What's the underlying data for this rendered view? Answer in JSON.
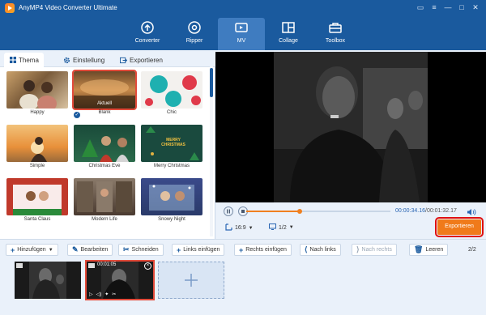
{
  "app": {
    "title": "AnyMP4 Video Converter Ultimate"
  },
  "nav": [
    {
      "label": "Converter",
      "icon": "converter-icon"
    },
    {
      "label": "Ripper",
      "icon": "ripper-icon"
    },
    {
      "label": "MV",
      "icon": "mv-icon"
    },
    {
      "label": "Collage",
      "icon": "collage-icon"
    },
    {
      "label": "Toolbox",
      "icon": "toolbox-icon"
    }
  ],
  "tabs": [
    {
      "label": "Thema"
    },
    {
      "label": "Einstellung"
    },
    {
      "label": "Exportieren"
    }
  ],
  "themes": [
    {
      "label": "Happy"
    },
    {
      "label": "Blank",
      "overlay": "Aktuell",
      "selected": true
    },
    {
      "label": "Chic"
    },
    {
      "label": "Simple"
    },
    {
      "label": "Christmas Eve"
    },
    {
      "label": "Merry Christmas",
      "overlay": "MERRY CHRISTMAS"
    },
    {
      "label": "Santa Claus"
    },
    {
      "label": "Modern Life"
    },
    {
      "label": "Snowy Night"
    }
  ],
  "player": {
    "current_time": "00:00:34.16",
    "separator": "/",
    "total_time": "00:01:32.17",
    "progress": 0.37,
    "aspect_ratio": "16:9",
    "page": "1/2",
    "export_label": "Exportieren"
  },
  "toolbar": {
    "add": "Hinzufügen",
    "edit": "Bearbeiten",
    "cut": "Schneiden",
    "insert_left": "Links einfügen",
    "insert_right": "Rechts einfügen",
    "move_left": "Nach links",
    "move_right": "Nach rechts",
    "empty": "Leeren",
    "page_count": "2/2"
  },
  "timeline": {
    "clip2_time": "00:01:05"
  },
  "colors": {
    "brand": "#1a5a9e",
    "accent": "#f07a1a",
    "highlight": "#e01010"
  }
}
